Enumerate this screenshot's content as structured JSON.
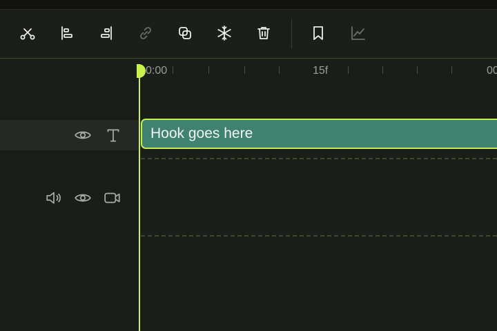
{
  "toolbar": {
    "tools": [
      {
        "name": "split",
        "icon": "scissors-icon",
        "enabled": true
      },
      {
        "name": "align-left",
        "icon": "align-left-icon",
        "enabled": true
      },
      {
        "name": "align-right",
        "icon": "align-right-icon",
        "enabled": true
      },
      {
        "name": "link",
        "icon": "link-icon",
        "enabled": false
      },
      {
        "name": "duplicate",
        "icon": "duplicate-icon",
        "enabled": true
      },
      {
        "name": "freeze",
        "icon": "snowflake-icon",
        "enabled": true
      },
      {
        "name": "delete",
        "icon": "trash-icon",
        "enabled": true
      },
      {
        "name": "bookmark",
        "icon": "bookmark-icon",
        "enabled": true
      },
      {
        "name": "graph",
        "icon": "graph-icon",
        "enabled": false
      }
    ]
  },
  "timeline": {
    "ruler": {
      "start_label": "0:00",
      "mid_label": "15f",
      "end_label": "00"
    },
    "tracks": [
      {
        "type": "text",
        "controls": [
          "eye-icon",
          "text-icon"
        ],
        "clip_label": "Hook goes here"
      },
      {
        "type": "video",
        "controls": [
          "speaker-icon",
          "eye-icon",
          "video-camera-icon"
        ]
      }
    ]
  },
  "colors": {
    "accent": "#c8f24a",
    "clip_fill": "#3f8270",
    "background": "#1b1d1a",
    "text_track_highlight": "#252925"
  }
}
